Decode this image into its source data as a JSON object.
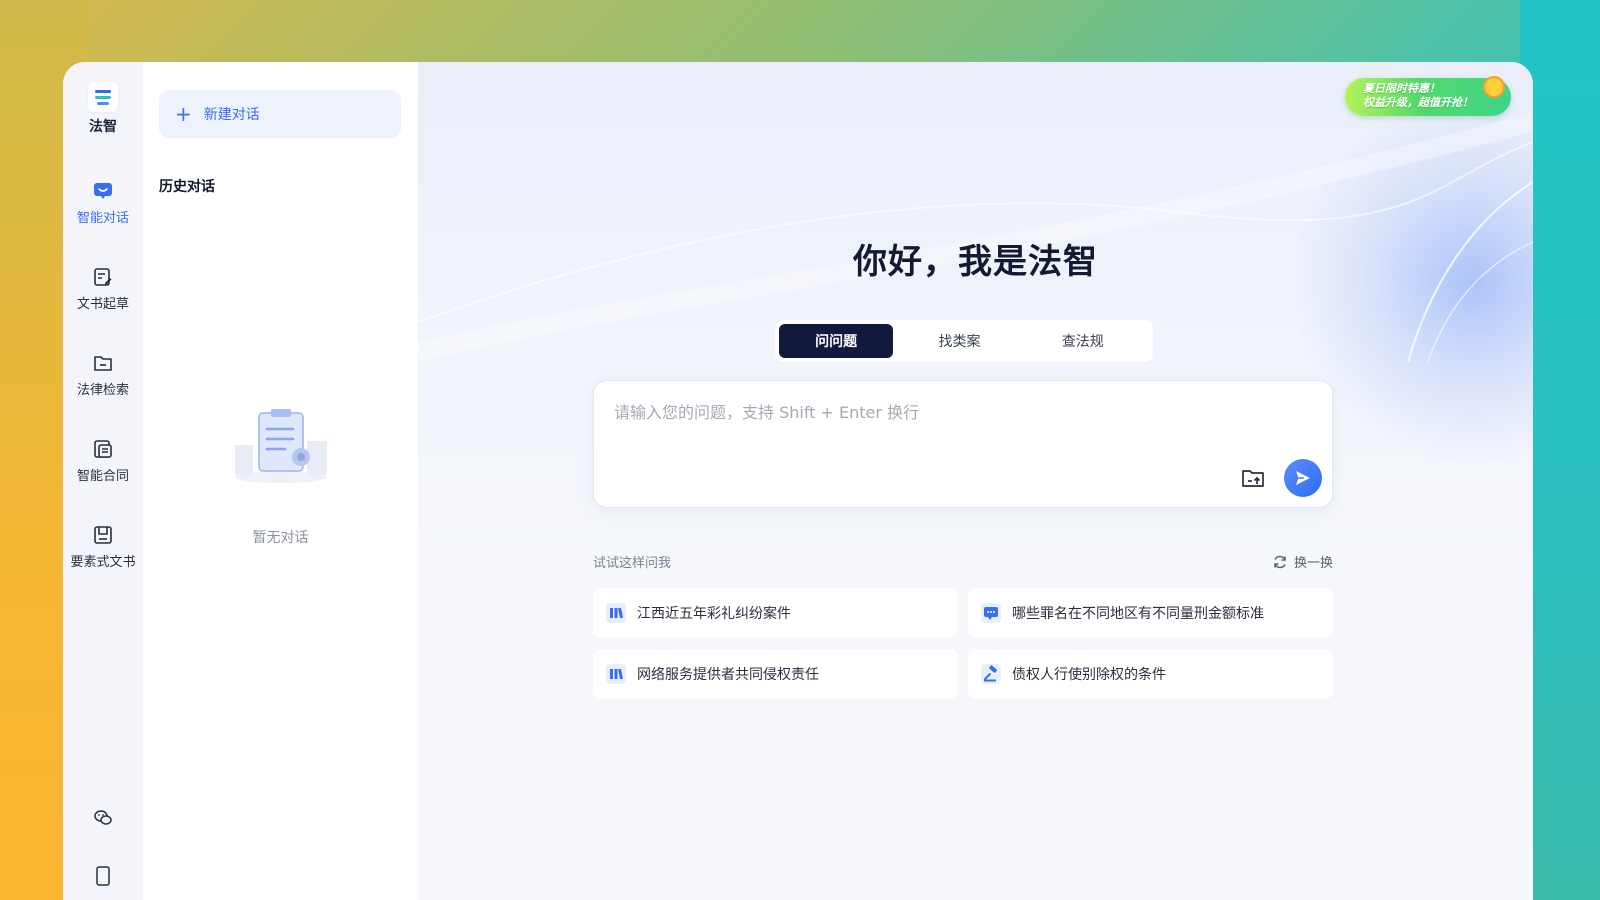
{
  "brand": {
    "name": "法智"
  },
  "rail": {
    "items": [
      {
        "label": "智能对话",
        "icon": "chat-bubble-icon",
        "active": true
      },
      {
        "label": "文书起草",
        "icon": "document-edit-icon",
        "active": false
      },
      {
        "label": "法律检索",
        "icon": "folder-icon",
        "active": false
      },
      {
        "label": "智能合同",
        "icon": "contract-icon",
        "active": false
      },
      {
        "label": "要素式文书",
        "icon": "form-document-icon",
        "active": false
      }
    ],
    "bottom_icons": [
      "wechat-icon",
      "mobile-phone-icon"
    ]
  },
  "history": {
    "new_chat_label": "新建对话",
    "title": "历史对话",
    "empty_text": "暂无对话"
  },
  "promo": {
    "line1": "夏日限时特惠！",
    "line2": "权益升级，超值开抢！"
  },
  "main": {
    "greeting": "你好，我是法智",
    "tabs": [
      {
        "label": "问问题",
        "active": true
      },
      {
        "label": "找类案",
        "active": false
      },
      {
        "label": "查法规",
        "active": false
      }
    ],
    "input_placeholder": "请输入您的问题，支持 Shift + Enter 换行",
    "try_label": "试试这样问我",
    "refresh_label": "换一换",
    "suggestions": [
      {
        "text": "江西近五年彩礼纠纷案件",
        "icon": "case-books-icon"
      },
      {
        "text": "哪些罪名在不同地区有不同量刑金额标准",
        "icon": "chat-dots-icon"
      },
      {
        "text": "网络服务提供者共同侵权责任",
        "icon": "case-books-icon"
      },
      {
        "text": "债权人行使别除权的条件",
        "icon": "gavel-icon"
      }
    ]
  },
  "colors": {
    "accent": "#3b6df0",
    "active_tab": "#111a3c",
    "promo_green": "#55d96c"
  }
}
